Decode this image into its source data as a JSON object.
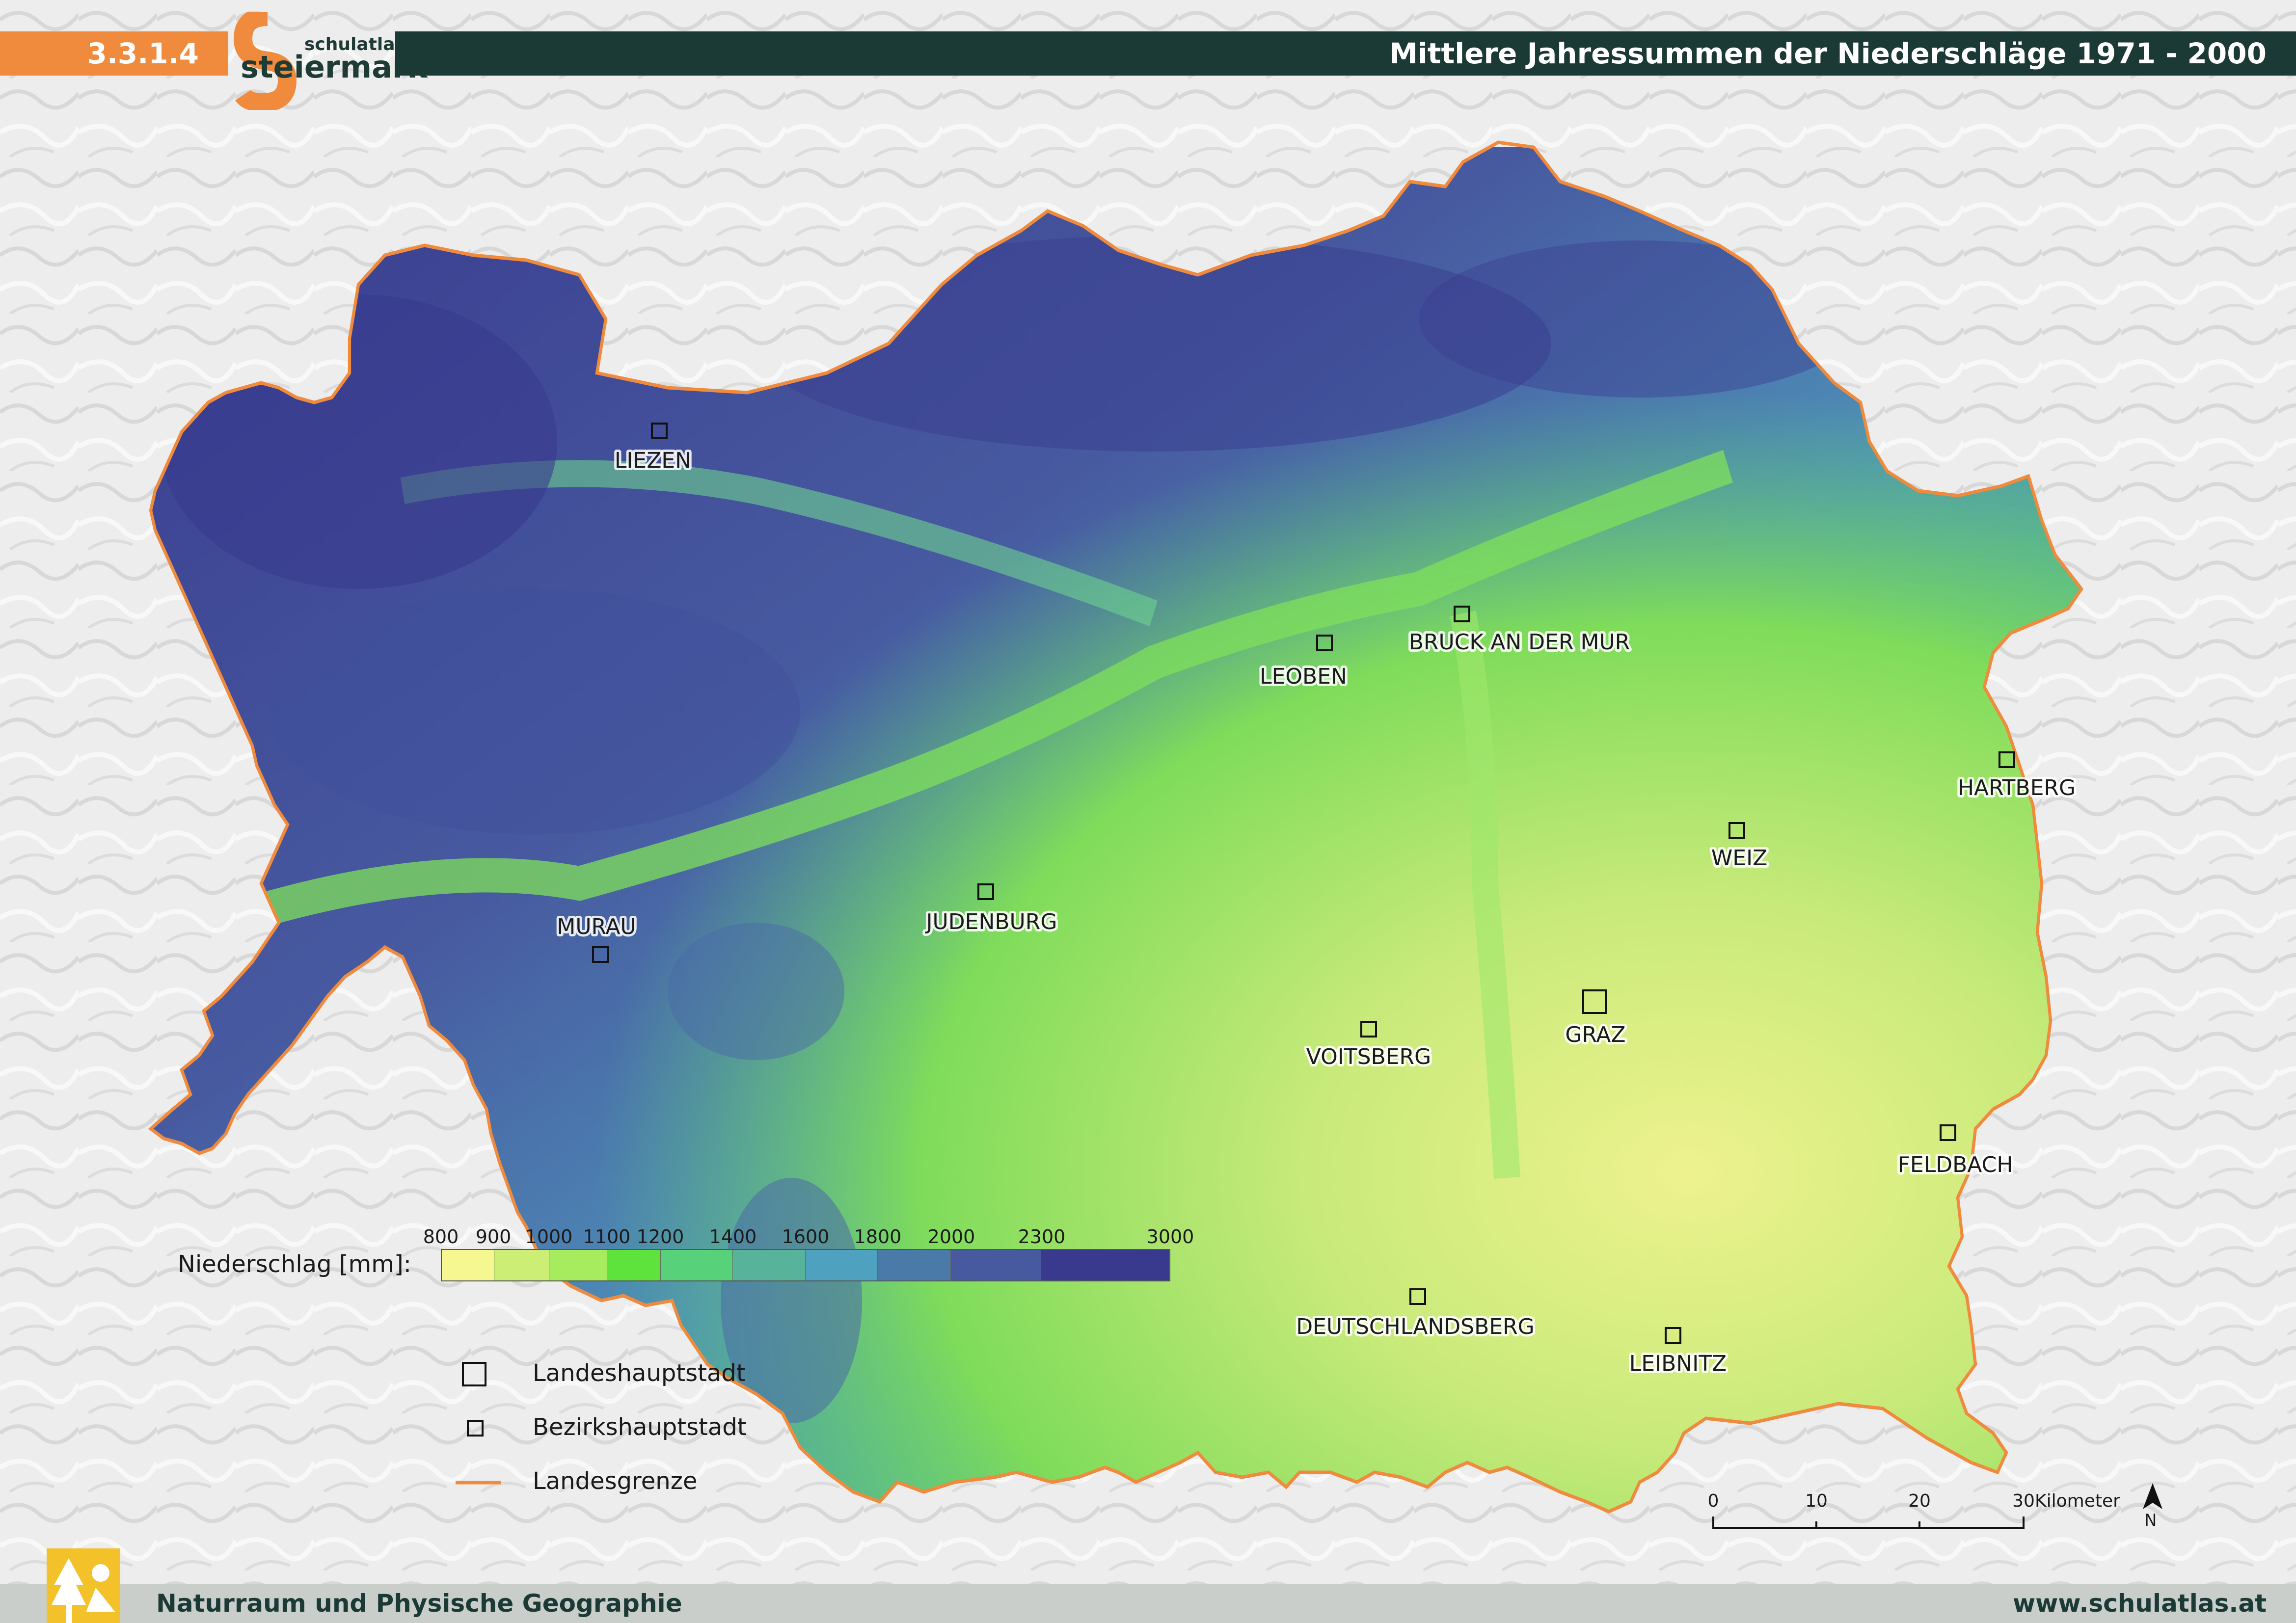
{
  "header": {
    "code": "3.3.1.4",
    "logo_small": "schulatlas",
    "logo_big": "steiermark",
    "title": "Mittlere Jahressummen der Niederschläge 1971 - 2000"
  },
  "footer": {
    "left": "Naturraum und Physische Geographie",
    "right": "www.schulatlas.at"
  },
  "cities": [
    {
      "name": "LIEZEN",
      "type": "bezirk"
    },
    {
      "name": "LEOBEN",
      "type": "bezirk"
    },
    {
      "name": "BRUCK AN DER MUR",
      "type": "bezirk"
    },
    {
      "name": "HARTBERG",
      "type": "bezirk"
    },
    {
      "name": "WEIZ",
      "type": "bezirk"
    },
    {
      "name": "MURAU",
      "type": "bezirk"
    },
    {
      "name": "JUDENBURG",
      "type": "bezirk"
    },
    {
      "name": "VOITSBERG",
      "type": "bezirk"
    },
    {
      "name": "GRAZ",
      "type": "landes"
    },
    {
      "name": "FELDBACH",
      "type": "bezirk"
    },
    {
      "name": "DEUTSCHLANDSBERG",
      "type": "bezirk"
    },
    {
      "name": "LEIBNITZ",
      "type": "bezirk"
    }
  ],
  "legend": {
    "title": "Niederschlag [mm]:",
    "ticks": [
      "800",
      "900",
      "1000",
      "1100",
      "1200",
      "1400",
      "1600",
      "1800",
      "2000",
      "2300",
      "3000"
    ],
    "colors": [
      "#f7f792",
      "#ccee75",
      "#a6ec5e",
      "#5de33c",
      "#58d27a",
      "#57b49a",
      "#4ea2bf",
      "#4a7aa8",
      "#475aa0",
      "#393a8e"
    ],
    "symbols": [
      {
        "label": "Landeshauptstadt",
        "kind": "large-square"
      },
      {
        "label": "Bezirkshauptstadt",
        "kind": "small-square"
      },
      {
        "label": "Landesgrenze",
        "kind": "orange-line"
      }
    ],
    "border_color": "#f08a3c"
  },
  "scale": {
    "ticks": [
      "0",
      "10",
      "20",
      "30"
    ],
    "unit": "Kilometer",
    "north": "N"
  }
}
